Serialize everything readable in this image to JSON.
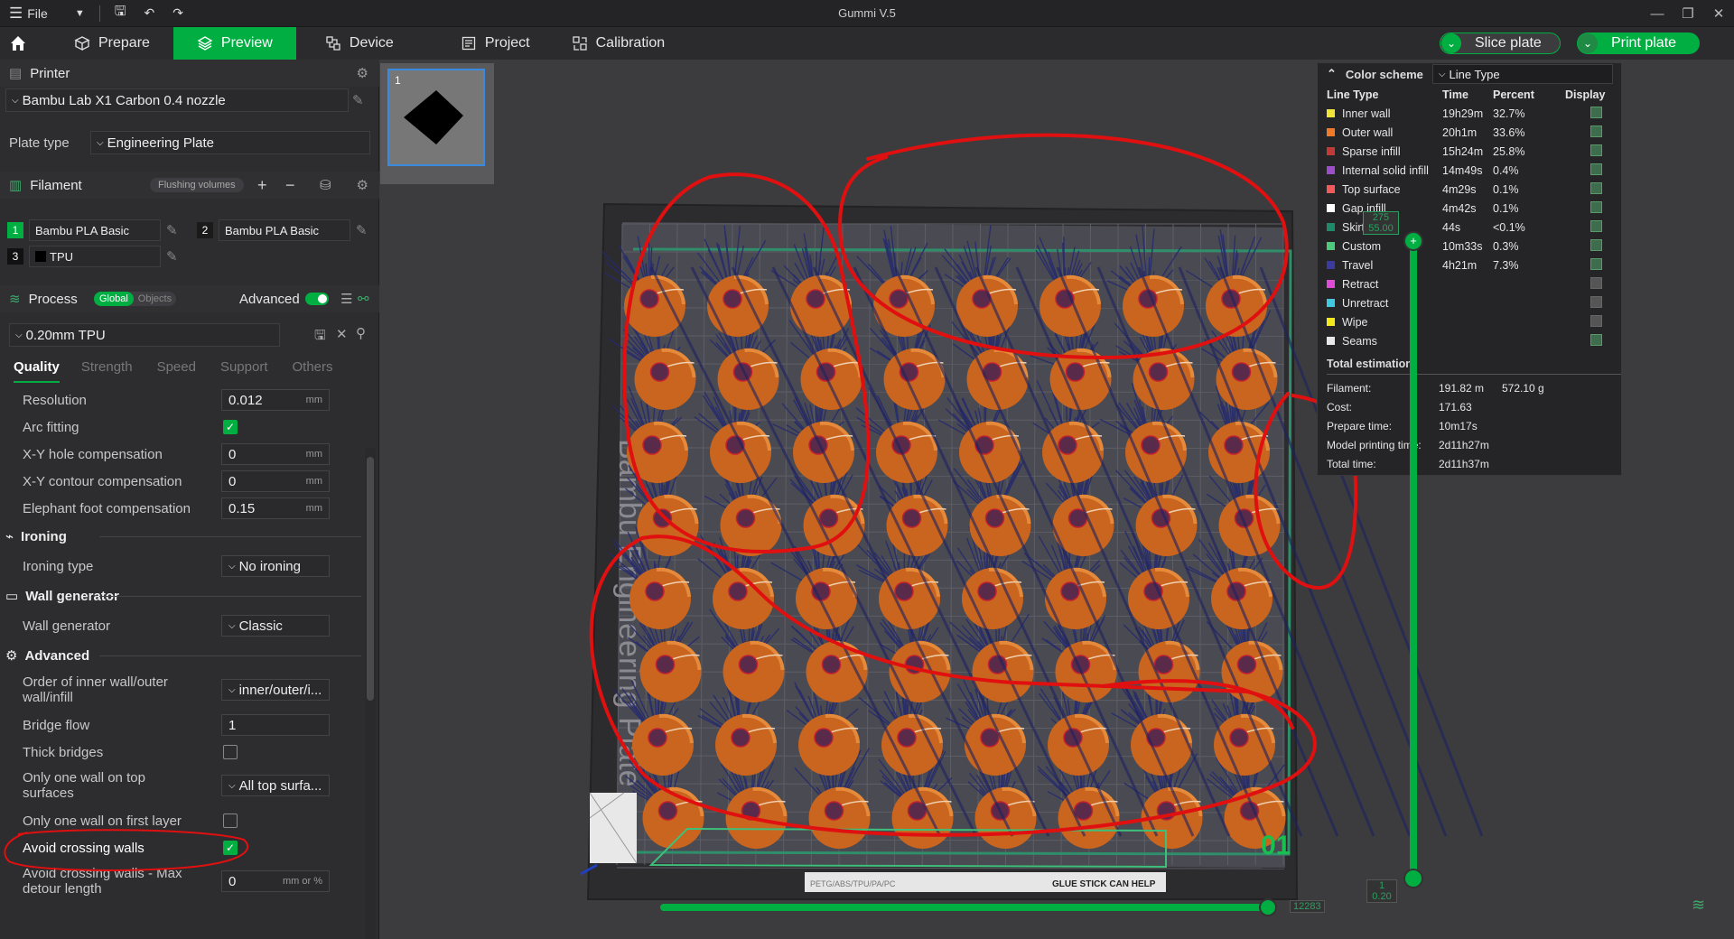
{
  "titlebar": {
    "file_label": "File",
    "app_title": "Gummi V.5"
  },
  "topbar": {
    "tabs": [
      {
        "label": "Prepare"
      },
      {
        "label": "Preview"
      },
      {
        "label": "Device"
      },
      {
        "label": "Project"
      },
      {
        "label": "Calibration"
      }
    ],
    "slice_label": "Slice plate",
    "print_label": "Print plate"
  },
  "printer": {
    "section": "Printer",
    "preset": "Bambu Lab X1 Carbon 0.4 nozzle",
    "plate_type_label": "Plate type",
    "plate_type": "Engineering Plate"
  },
  "filament": {
    "section": "Filament",
    "flushing_label": "Flushing volumes",
    "slots": [
      {
        "num": "1",
        "name": "Bambu PLA Basic",
        "color": "#00ae42"
      },
      {
        "num": "2",
        "name": "Bambu PLA Basic",
        "color": "#1a1a1a"
      },
      {
        "num": "3",
        "name": "TPU",
        "color": "#111111"
      }
    ]
  },
  "process": {
    "section": "Process",
    "global_label": "Global",
    "objects_label": "Objects",
    "advanced_label": "Advanced",
    "preset": "0.20mm TPU",
    "tabs": [
      "Quality",
      "Strength",
      "Speed",
      "Support",
      "Others"
    ]
  },
  "settings": {
    "resolution": {
      "label": "Resolution",
      "value": "0.012",
      "unit": "mm"
    },
    "arc_fitting": {
      "label": "Arc fitting"
    },
    "xy_hole": {
      "label": "X-Y hole compensation",
      "value": "0",
      "unit": "mm"
    },
    "xy_contour": {
      "label": "X-Y contour compensation",
      "value": "0",
      "unit": "mm"
    },
    "elephant": {
      "label": "Elephant foot compensation",
      "value": "0.15",
      "unit": "mm"
    },
    "ironing_group": "Ironing",
    "ironing_type": {
      "label": "Ironing type",
      "value": "No ironing"
    },
    "wall_group": "Wall generator",
    "wall_generator": {
      "label": "Wall generator",
      "value": "Classic"
    },
    "advanced_group": "Advanced",
    "wall_order": {
      "label": "Order of inner wall/outer wall/infill",
      "value": "inner/outer/i..."
    },
    "bridge_flow": {
      "label": "Bridge flow",
      "value": "1"
    },
    "thick_bridges": {
      "label": "Thick bridges"
    },
    "one_wall_top": {
      "label": "Only one wall on top surfaces",
      "value": "All top surfa..."
    },
    "one_wall_first": {
      "label": "Only one wall on first layer"
    },
    "avoid_crossing": {
      "label": "Avoid crossing walls"
    },
    "avoid_detour": {
      "label": "Avoid crossing walls - Max detour length",
      "value": "0",
      "unit": "mm or %"
    }
  },
  "legend": {
    "title": "Color scheme",
    "scheme": "Line Type",
    "headers": [
      "Line Type",
      "Time",
      "Percent",
      "Display"
    ],
    "rows": [
      {
        "name": "Inner wall",
        "time": "19h29m",
        "percent": "32.7%",
        "color": "#f2e33a",
        "display": true
      },
      {
        "name": "Outer wall",
        "time": "20h1m",
        "percent": "33.6%",
        "color": "#f07a2a",
        "display": true
      },
      {
        "name": "Sparse infill",
        "time": "15h24m",
        "percent": "25.8%",
        "color": "#c03a38",
        "display": true
      },
      {
        "name": "Internal solid infill",
        "time": "14m49s",
        "percent": "0.4%",
        "color": "#9a4fc8",
        "display": true
      },
      {
        "name": "Top surface",
        "time": "4m29s",
        "percent": "0.1%",
        "color": "#f05a5a",
        "display": true
      },
      {
        "name": "Gap infill",
        "time": "4m42s",
        "percent": "0.1%",
        "color": "#ffffff",
        "display": true
      },
      {
        "name": "Skirt",
        "time": "44s",
        "percent": "<0.1%",
        "color": "#1f8a6a",
        "display": true
      },
      {
        "name": "Custom",
        "time": "10m33s",
        "percent": "0.3%",
        "color": "#4ec87a",
        "display": true
      },
      {
        "name": "Travel",
        "time": "4h21m",
        "percent": "7.3%",
        "color": "#3a3aa0",
        "display": true
      },
      {
        "name": "Retract",
        "time": "",
        "percent": "",
        "color": "#e04ad8",
        "display": false
      },
      {
        "name": "Unretract",
        "time": "",
        "percent": "",
        "color": "#40c8e0",
        "display": false
      },
      {
        "name": "Wipe",
        "time": "",
        "percent": "",
        "color": "#f2e81a",
        "display": false
      },
      {
        "name": "Seams",
        "time": "",
        "percent": "",
        "color": "#e8e8e8",
        "display": true
      }
    ],
    "total_title": "Total estimation",
    "totals": [
      {
        "label": "Filament:",
        "value": "191.82 m",
        "value2": "572.10 g"
      },
      {
        "label": "Cost:",
        "value": "171.63",
        "value2": ""
      },
      {
        "label": "Prepare time:",
        "value": "10m17s",
        "value2": ""
      },
      {
        "label": "Model printing time:",
        "value": "2d11h27m",
        "value2": ""
      },
      {
        "label": "Total time:",
        "value": "2d11h37m",
        "value2": ""
      }
    ]
  },
  "thumb": {
    "label": "1"
  },
  "plate": {
    "number": "01",
    "side_text": "Bambu Engineering Plate",
    "bottom_text": "GLUE STICK CAN HELP",
    "bottom_code": "PETG/ABS/TPU/PA/PC"
  },
  "vslider": {
    "top_layer": "275",
    "top_height": "55.00",
    "bottom_layer": "1",
    "bottom_height": "0.20"
  },
  "hslider": {
    "value": "12283"
  },
  "colors": {
    "accent": "#00ae42",
    "annotation": "#e01010"
  }
}
